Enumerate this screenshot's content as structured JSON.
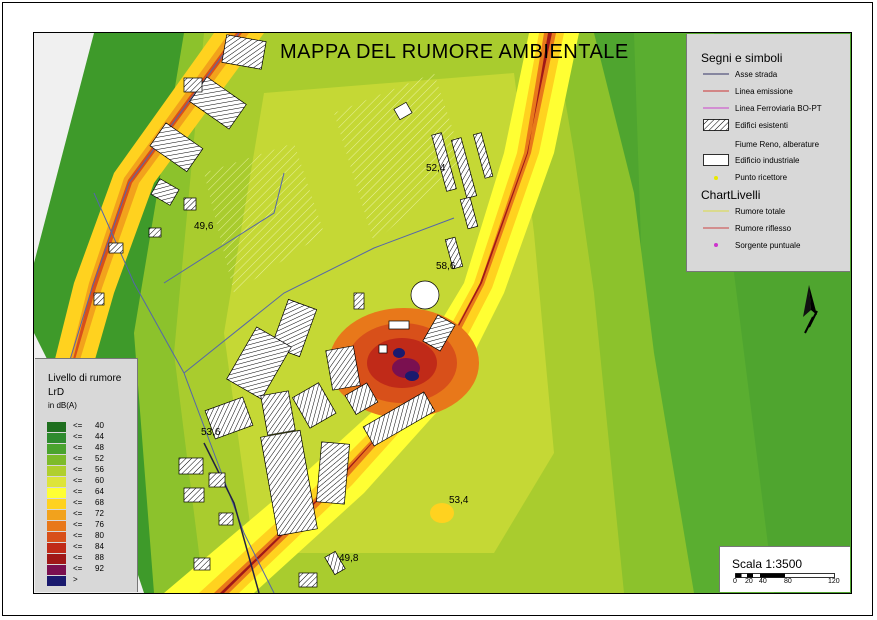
{
  "title": "MAPPA DEL RUMORE AMBIENTALE",
  "receptor_labels": [
    "52,4",
    "49,6",
    "58,6",
    "53,6",
    "53,4",
    "49,8"
  ],
  "legend_symbols": {
    "title": "Segni e simboli",
    "items": [
      {
        "label": "Asse strada",
        "icon": "line-dark",
        "color": "#333366"
      },
      {
        "label": "Linea emissione",
        "icon": "line-red",
        "color": "#cc3333"
      },
      {
        "label": "Linea Ferroviaria BO-PT",
        "icon": "line-magenta",
        "color": "#cc44cc"
      },
      {
        "label": "Edifici esistenti",
        "icon": "hatched-box",
        "color": "#000000"
      },
      {
        "label": "Fiume Reno, alberature",
        "icon": "none",
        "color": "#d8d8d8"
      },
      {
        "label": "Edificio industriale",
        "icon": "white-box",
        "color": "#ffffff"
      },
      {
        "label": "Punto ricettore",
        "icon": "yellow-dot",
        "color": "#e8e800"
      }
    ],
    "chart_title": "ChartLivelli",
    "chart_items": [
      {
        "label": "Rumore totale",
        "icon": "line-yellow",
        "color": "#dddd44"
      },
      {
        "label": "Rumore riflesso",
        "icon": "line-red",
        "color": "#cc4444"
      },
      {
        "label": "Sorgente puntuale",
        "icon": "magenta-dot",
        "color": "#cc33cc"
      }
    ]
  },
  "legend_levels": {
    "title_line1": "Livello di rumore",
    "title_line2": "LrD",
    "title_line3": "in dB(A)",
    "rows": [
      {
        "op": "<=",
        "value": "40",
        "color": "#1f6f1f"
      },
      {
        "op": "<=",
        "value": "44",
        "color": "#2e8b2e"
      },
      {
        "op": "<=",
        "value": "48",
        "color": "#4aa32e"
      },
      {
        "op": "<=",
        "value": "52",
        "color": "#7dbb2a"
      },
      {
        "op": "<=",
        "value": "56",
        "color": "#b0cf2e"
      },
      {
        "op": "<=",
        "value": "60",
        "color": "#dde43a"
      },
      {
        "op": "<=",
        "value": "64",
        "color": "#ffff33"
      },
      {
        "op": "<=",
        "value": "68",
        "color": "#ffd21f"
      },
      {
        "op": "<=",
        "value": "72",
        "color": "#f2a21c"
      },
      {
        "op": "<=",
        "value": "76",
        "color": "#e8781a"
      },
      {
        "op": "<=",
        "value": "80",
        "color": "#d8501a"
      },
      {
        "op": "<=",
        "value": "84",
        "color": "#c02a18"
      },
      {
        "op": "<=",
        "value": "88",
        "color": "#a01818"
      },
      {
        "op": "<=",
        "value": "92",
        "color": "#7a1050"
      },
      {
        "op": ">",
        "value": "",
        "color": "#1a1a6e"
      }
    ]
  },
  "scale": {
    "label": "Scala 1:3500",
    "ticks": [
      "0",
      "20",
      "40",
      "80",
      "120"
    ]
  },
  "north_arrow": {
    "icon": "north-arrow-icon",
    "letter": "N"
  }
}
